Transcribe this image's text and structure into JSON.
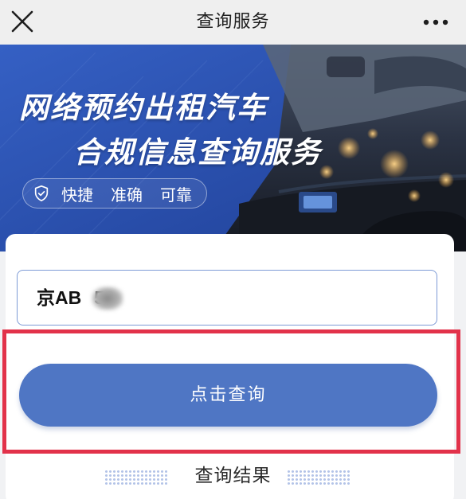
{
  "header": {
    "title": "查询服务",
    "close_icon": "close-icon",
    "more_icon": "more-dots-icon"
  },
  "banner": {
    "headline_line1": "网络预约出租汽车",
    "headline_line2": "合规信息查询服务",
    "slogan_icon": "shield-check-icon",
    "slogan_words": [
      "快捷",
      "准确",
      "可靠"
    ]
  },
  "search": {
    "plate_value_prefix": "京AB",
    "plate_value_suffix": "56"
  },
  "actions": {
    "query_label": "点击查询"
  },
  "results": {
    "title": "查询结果"
  },
  "colors": {
    "banner_blue": "#2f55b4",
    "button_blue": "#4f76c4",
    "highlight_red": "#e2324a",
    "input_border": "#7e9bd6"
  }
}
